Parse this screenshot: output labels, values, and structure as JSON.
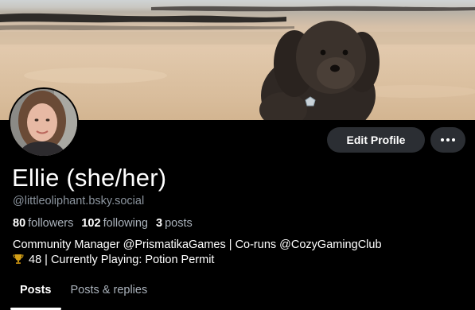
{
  "profile": {
    "display_name": "Ellie (she/her)",
    "handle": "@littleoliphant.bsky.social",
    "stats": {
      "followers_count": "80",
      "followers_label": "followers",
      "following_count": "102",
      "following_label": "following",
      "posts_count": "3",
      "posts_label": "posts"
    },
    "bio": {
      "line1": "Community Manager @PrismatikaGames | Co-runs @CozyGamingClub",
      "line2": "48 | Currently Playing: Potion Permit"
    }
  },
  "actions": {
    "edit_profile_label": "Edit Profile",
    "more_icon": "ellipsis-icon"
  },
  "tabs": [
    {
      "label": "Posts",
      "active": true
    },
    {
      "label": "Posts & replies",
      "active": false
    }
  ],
  "icons": {
    "bio_prefix": "trophy-icon"
  },
  "colors": {
    "background": "#000000",
    "button_bg": "#2b2e33",
    "muted_text": "#8b949e",
    "trophy": "#d4a017"
  }
}
